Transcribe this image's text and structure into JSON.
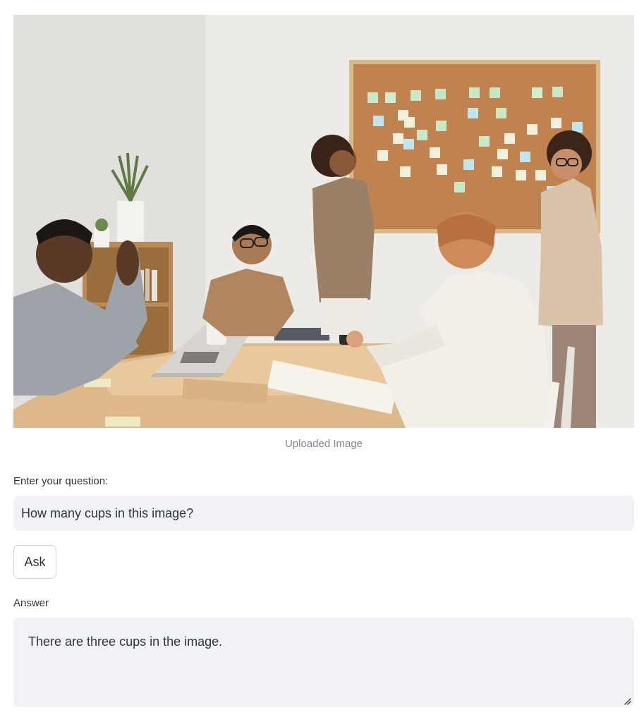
{
  "image": {
    "caption": "Uploaded Image",
    "alt": "Uploaded Image"
  },
  "question": {
    "label": "Enter your question:",
    "value": "How many cups in this image?"
  },
  "ask_button": {
    "label": "Ask"
  },
  "answer": {
    "label": "Answer",
    "value": "There are three cups in the image."
  },
  "icons": {
    "resize": "resize-grip-icon"
  },
  "colors": {
    "input_bg": "#f0f2f6",
    "text": "#31333f",
    "caption": "#808495",
    "button_border": "#d0d2d8"
  }
}
